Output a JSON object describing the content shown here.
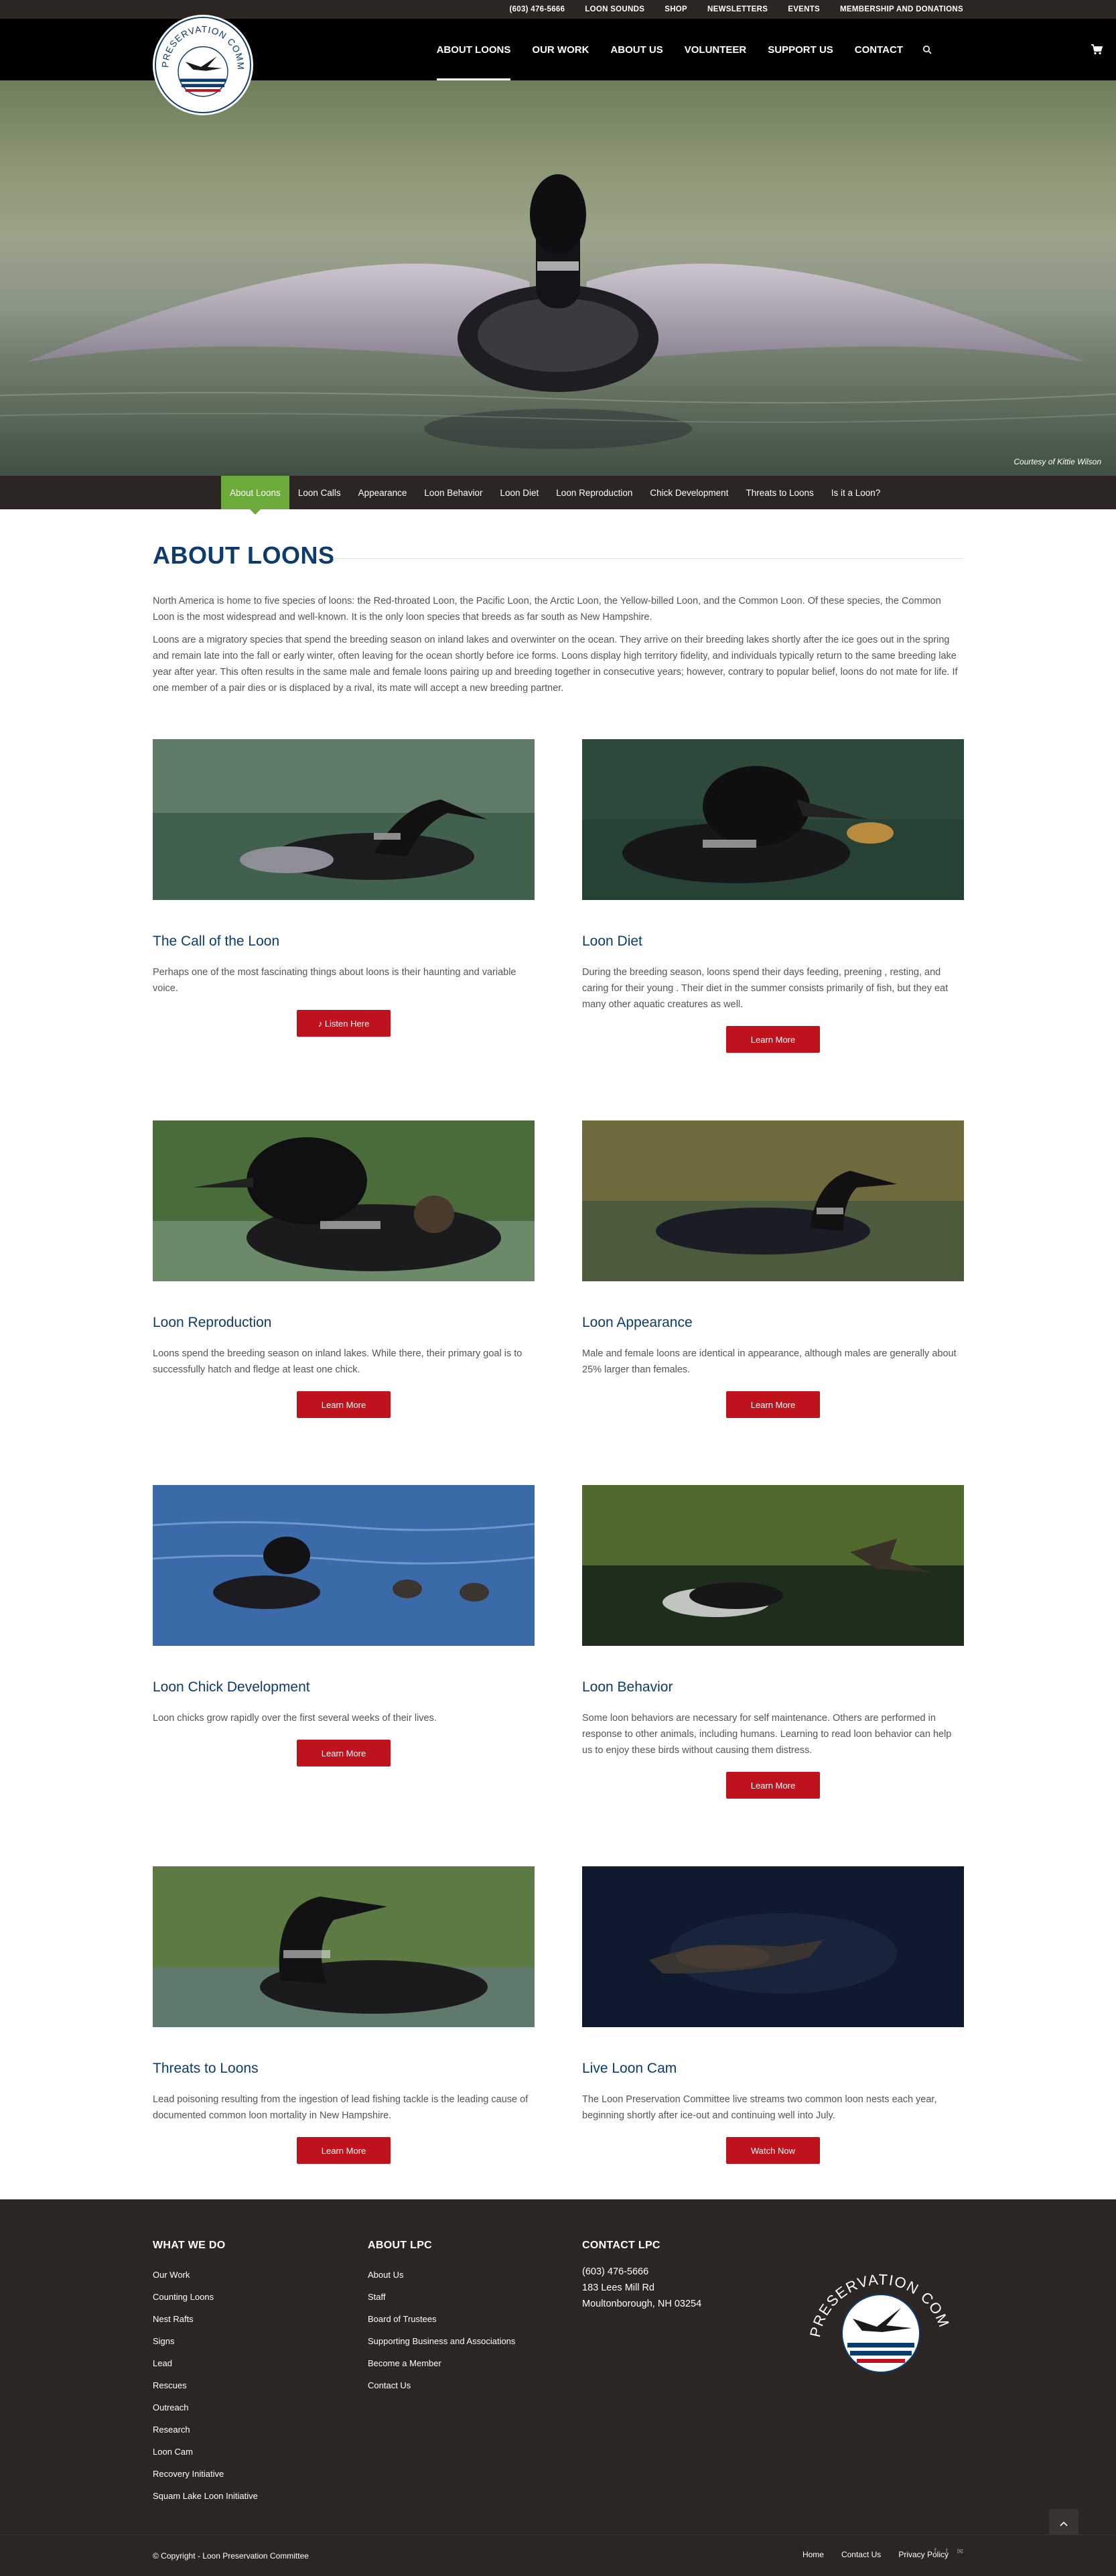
{
  "topbar": {
    "phone": "(603) 476-5666",
    "links": [
      "LOON SOUNDS",
      "SHOP",
      "NEWSLETTERS",
      "EVENTS",
      "MEMBERSHIP AND DONATIONS"
    ]
  },
  "logo": {
    "text_top": "LOON PRESERVATION COMMITTEE"
  },
  "nav": {
    "items": [
      "ABOUT LOONS",
      "OUR WORK",
      "ABOUT US",
      "VOLUNTEER",
      "SUPPORT US",
      "CONTACT"
    ],
    "active": "ABOUT LOONS"
  },
  "hero": {
    "credit": "Courtesy of Kittie Wilson"
  },
  "subnav": {
    "items": [
      "About Loons",
      "Loon Calls",
      "Appearance",
      "Loon Behavior",
      "Loon Diet",
      "Loon Reproduction",
      "Chick Development",
      "Threats to Loons",
      "Is it a Loon?"
    ],
    "active": "About Loons"
  },
  "intro": {
    "title": "ABOUT LOONS",
    "p1": "North America is home to five species of loons: the Red-throated Loon, the Pacific Loon, the Arctic Loon, the Yellow-billed Loon, and the Common Loon. Of these species, the Common Loon is the most widespread and well-known. It is the only loon species that breeds as far south as New Hampshire.",
    "p2": "Loons are a migratory species that spend the breeding season on inland lakes and overwinter on the ocean. They arrive on their breeding lakes shortly after the ice goes out in the spring and remain late into the fall or early winter, often leaving for the ocean shortly before ice forms. Loons display high territory fidelity, and individuals typically return to the same breeding lake year after year. This often results in the same male and female loons pairing up and breeding together in consecutive years; however, contrary to popular belief, loons do not mate for life. If one member of a pair dies or is displaced by a rival, its mate will accept a new breeding partner."
  },
  "cards": [
    {
      "title": "The Call of the Loon",
      "text": "Perhaps one of the most fascinating things about loons is their haunting and variable voice.",
      "button": "♪ Listen Here"
    },
    {
      "title": "Loon Diet",
      "text": "During the breeding season, loons spend their days feeding, preening , resting, and caring for their young . Their diet in the summer consists primarily of fish, but they eat many other aquatic creatures as well.",
      "button": "Learn More"
    },
    {
      "title": "Loon Reproduction",
      "text": "Loons spend the breeding season on inland lakes. While there, their primary goal is to successfully hatch and fledge at least one chick.",
      "button": "Learn More"
    },
    {
      "title": "Loon Appearance",
      "text": "Male and female loons are identical in appearance, although males are generally about 25% larger than females.",
      "button": "Learn More"
    },
    {
      "title": "Loon Chick Development",
      "text": "Loon chicks grow rapidly over the first several weeks of their lives.",
      "button": "Learn More"
    },
    {
      "title": "Loon Behavior",
      "text": "Some loon behaviors are necessary for self maintenance. Others are performed in response to other animals, including humans. Learning to read loon behavior can help us to enjoy these birds without causing them distress.",
      "button": "Learn More"
    },
    {
      "title": "Threats to Loons",
      "text": "Lead poisoning resulting from the ingestion of lead fishing tackle is the leading cause of documented common loon mortality in New Hampshire.",
      "button": "Learn More"
    },
    {
      "title": "Live Loon Cam",
      "text": "The Loon Preservation Committee live streams two common loon nests each year, beginning shortly after ice-out and continuing well into July.",
      "button": "Watch Now"
    }
  ],
  "footer": {
    "what_we_do": {
      "heading": "WHAT WE DO",
      "links": [
        "Our Work",
        "Counting Loons",
        "Nest Rafts",
        "Signs",
        "Lead",
        "Rescues",
        "Outreach",
        "Research",
        "Loon Cam",
        "Recovery Initiative",
        "Squam Lake Loon Initiative"
      ]
    },
    "about": {
      "heading": "ABOUT LPC",
      "links": [
        "About Us",
        "Staff",
        "Board of Trustees",
        "Supporting Business and Associations",
        "Become a Member",
        "Contact Us"
      ]
    },
    "contact": {
      "heading": "CONTACT LPC",
      "phone": "(603) 476-5666",
      "street": "183 Lees Mill Rd",
      "city": "Moultonborough, NH 03254"
    },
    "copyright": "© Copyright - Loon Preservation Committee",
    "bottom_links": [
      "Home",
      "Contact Us",
      "Privacy Policy"
    ],
    "social_icons": [
      "facebook-icon",
      "twitter-icon",
      "mail-icon"
    ]
  },
  "colors": {
    "navy": "#0c3b6e",
    "red": "#c0121c",
    "green": "#6cab3b",
    "dark": "#2b2623"
  }
}
